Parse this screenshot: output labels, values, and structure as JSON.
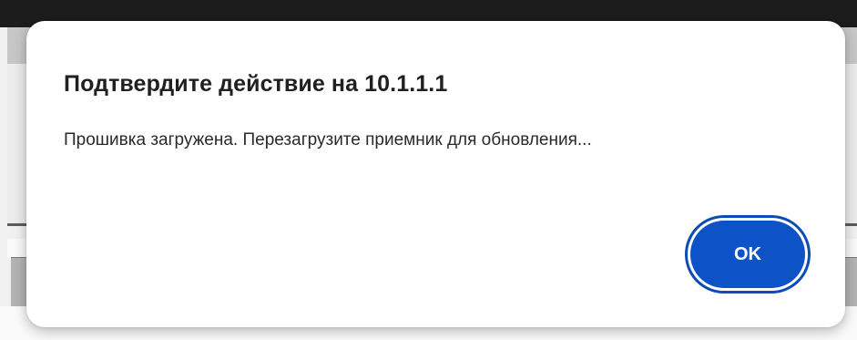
{
  "dialog": {
    "title": "Подтвердите действие на 10.1.1.1",
    "message": "Прошивка загружена. Перезагрузите приемник для обновления...",
    "ok_label": "OK"
  },
  "colors": {
    "accent": "#0e52c7",
    "dialog_background": "#ffffff",
    "title_text": "#202020"
  }
}
